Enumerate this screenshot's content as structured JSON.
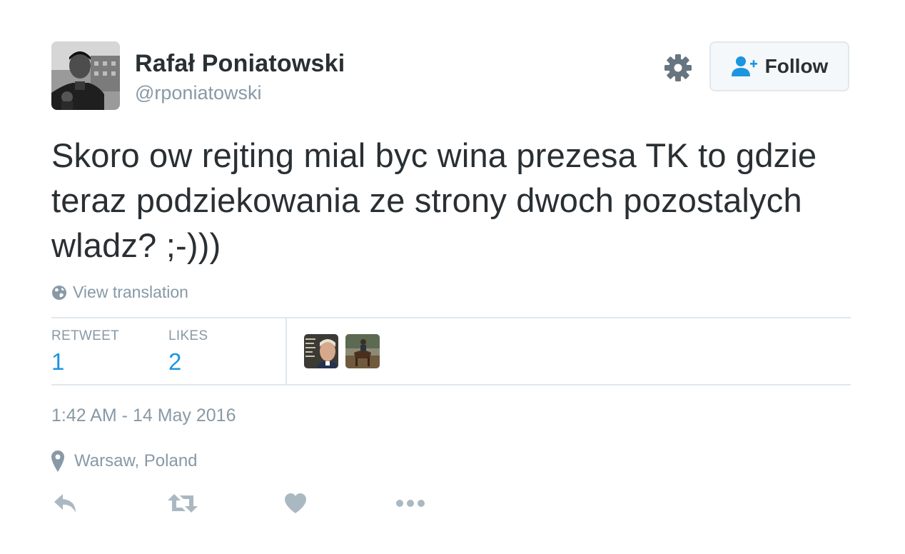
{
  "author": {
    "fullname": "Rafał Poniatowski",
    "handle": "@rponiatowski",
    "avatar": "profile-photo"
  },
  "header": {
    "settings_icon": "gear-icon",
    "follow_icon": "add-user-icon",
    "follow_label": "Follow"
  },
  "tweet": {
    "text": "Skoro ow rejting mial byc wina prezesa TK to gdzie teraz podziekowania ze strony dwoch pozostalych wladz? ;-)))",
    "translate_icon": "globe-icon",
    "translate_label": "View translation"
  },
  "stats": {
    "retweets_label": "RETWEET",
    "retweets_count": "1",
    "likes_label": "LIKES",
    "likes_count": "2",
    "likers": [
      "liker-avatar-1",
      "liker-avatar-2"
    ]
  },
  "meta": {
    "timestamp": "1:42 AM - 14 May 2016",
    "location_icon": "map-pin-icon",
    "location": "Warsaw, Poland"
  },
  "actions": [
    "reply-icon",
    "retweet-icon",
    "like-icon",
    "more-icon"
  ],
  "colors": {
    "text": "#292f33",
    "secondary": "#8899a6",
    "accent": "#1b95e0",
    "border": "#e1e8ed",
    "button_bg": "#f5f8fa"
  }
}
